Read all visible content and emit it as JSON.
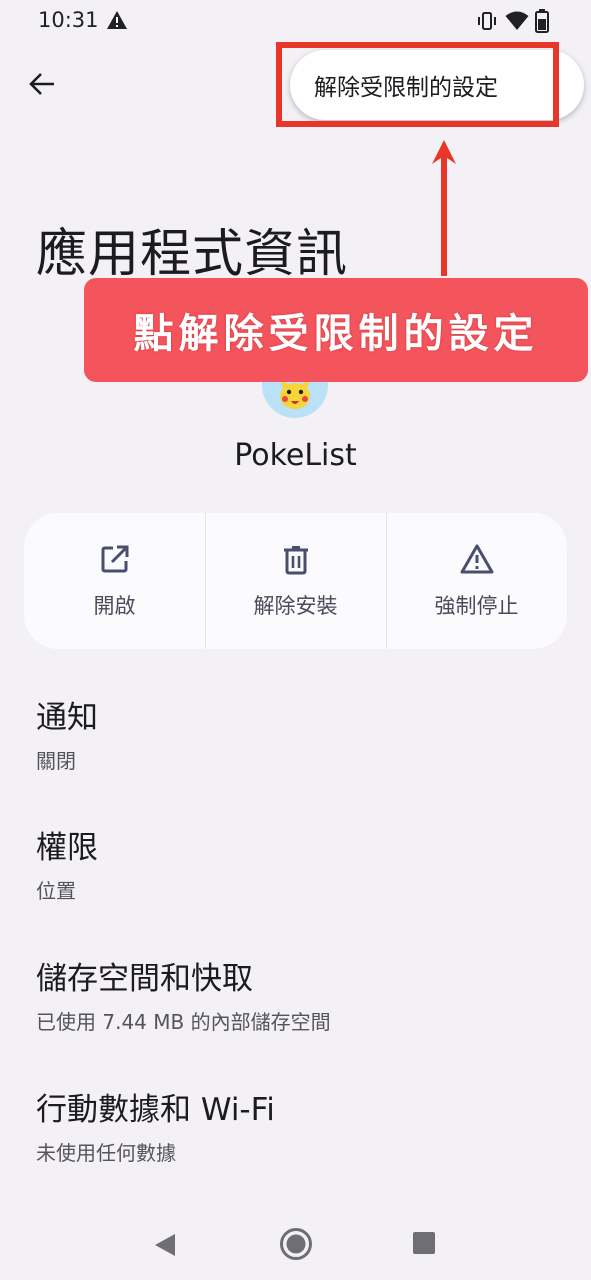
{
  "status_bar": {
    "time": "10:31",
    "icons": [
      "warning-icon",
      "vibrate-icon",
      "wifi-icon",
      "battery-icon"
    ]
  },
  "toolbar": {
    "back_icon": "arrow-back-icon",
    "overflow_menu_item": "解除受限制的設定"
  },
  "annotation": {
    "callout_text": "點解除受限制的設定",
    "highlight_color": "#e8362a",
    "callout_color": "#f4545b"
  },
  "page": {
    "title": "應用程式資訊",
    "app_name": "PokeList",
    "app_icon": "pikachu-app-icon"
  },
  "actions": [
    {
      "label": "開啟",
      "icon": "open-external-icon"
    },
    {
      "label": "解除安裝",
      "icon": "trash-icon"
    },
    {
      "label": "強制停止",
      "icon": "warning-triangle-icon"
    }
  ],
  "settings": [
    {
      "title": "通知",
      "subtitle": "關閉"
    },
    {
      "title": "權限",
      "subtitle": "位置"
    },
    {
      "title": "儲存空間和快取",
      "subtitle": "已使用 7.44 MB 的內部儲存空間"
    },
    {
      "title": "行動數據和 Wi-Fi",
      "subtitle": "未使用任何數據"
    }
  ],
  "nav_bar": {
    "buttons": [
      "nav-back-icon",
      "nav-home-icon",
      "nav-recents-icon"
    ]
  }
}
